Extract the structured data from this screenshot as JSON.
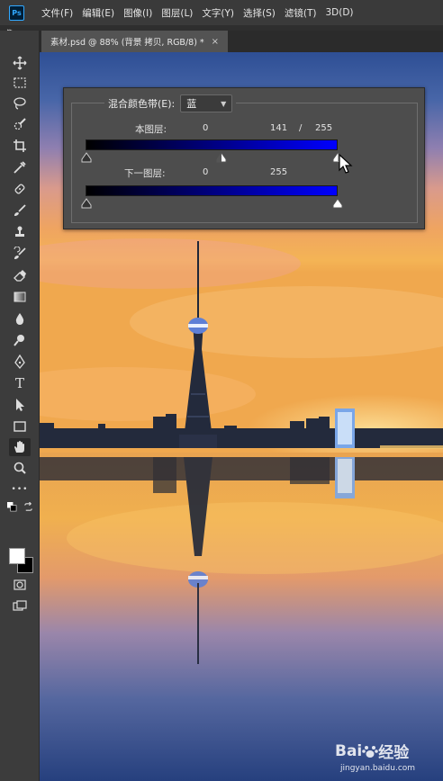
{
  "app": {
    "logo": "Ps"
  },
  "menu": [
    "文件(F)",
    "编辑(E)",
    "图像(I)",
    "图层(L)",
    "文字(Y)",
    "选择(S)",
    "滤镜(T)",
    "3D(D)"
  ],
  "document": {
    "tab_title": "素材.psd @ 88% (背景 拷贝, RGB/8) *",
    "close": "×"
  },
  "tools": [
    "move-icon",
    "marquee-icon",
    "lasso-icon",
    "quick-select-icon",
    "crop-icon",
    "eyedropper-icon",
    "healing-icon",
    "brush-icon",
    "stamp-icon",
    "history-brush-icon",
    "eraser-icon",
    "gradient-icon",
    "blur-icon",
    "dodge-icon",
    "pen-icon",
    "type-icon",
    "path-select-icon",
    "rectangle-icon",
    "hand-icon",
    "zoom-icon",
    "more-icon"
  ],
  "tool_type_glyph": "T",
  "more_glyph": "•••",
  "colors": {
    "foreground": "#ffffff",
    "background": "#000000",
    "blend_end": "#0000ff"
  },
  "blend_if": {
    "label": "混合颜色带(E):",
    "channel": "蓝",
    "this_layer": {
      "label": "本图层:",
      "black": "0",
      "white_low": "141",
      "separator": "/",
      "white_high": "255"
    },
    "underlying_layer": {
      "label": "下一图层:",
      "black": "0",
      "white": "255"
    }
  },
  "watermark": {
    "brand": "Bai",
    "brand_suffix": "经验",
    "url": "jingyan.baidu.com"
  }
}
